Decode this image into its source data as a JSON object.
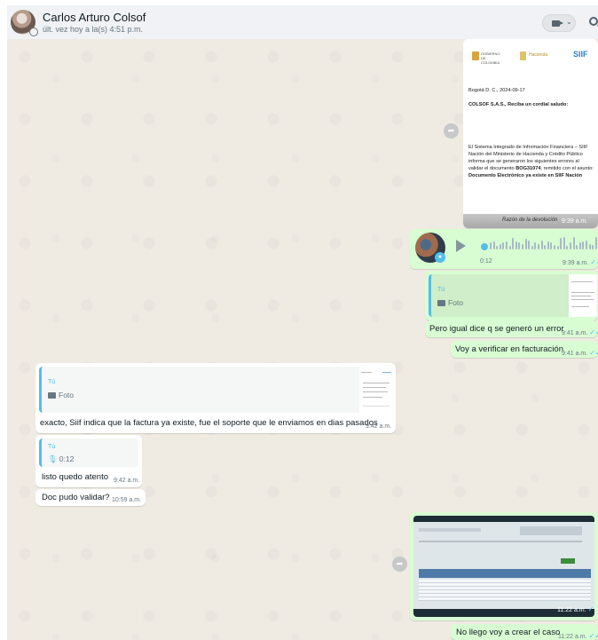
{
  "header": {
    "contact_name": "Carlos Arturo Colsof",
    "status": "últ. vez hoy a la(s) 4:51 p.m.",
    "video_chevron": "⌄"
  },
  "colors": {
    "outgoing": "#d9fdd3",
    "incoming": "#ffffff",
    "chat_bg": "#efeae2",
    "header_bg": "#f0f2f5",
    "accent": "#53bdeb"
  },
  "messages": {
    "doc": {
      "logo_left": "GOBIERNO DE COLOMBIA",
      "logo_mid": "Hacienda",
      "logo_right": "SIIF",
      "date_line": "Bogotá D. C., 2024-09-17",
      "greeting": "COLSOF S.A.S., Reciba un cordial saludo:",
      "body_a": "El Sistema Integrado de Información Financiera – SIIF Nación del Ministerio de Hacienda y Crédito Público informa que se generaron los siguientes errores al validar el documento",
      "doc_id": "BOG31074",
      "body_b": ", remitido con el asunto:",
      "subject": "Documento Electrónico ya existe en SIIF Nación",
      "footer": "Razón de la devolución",
      "time": "9:39 a.m."
    },
    "audio": {
      "duration": "0:12",
      "time": "9:39 a.m.",
      "ticks": "✓✓"
    },
    "quoted_photo_out": {
      "author": "Tú",
      "label": "Foto"
    },
    "out_1": {
      "text": "Pero igual dice q se generó un error",
      "time": "9:41 a.m.",
      "ticks": "✓✓"
    },
    "out_2": {
      "text": "Voy a verificar en facturación",
      "time": "9:41 a.m.",
      "ticks": "✓✓"
    },
    "in_1": {
      "quote_author": "Tú",
      "quote_label": "Foto",
      "text": "exacto, Siif indica que la factura ya existe, fue el soporte que le enviamos en dias pasados",
      "time": "9:42 a.m."
    },
    "in_2": {
      "quote_author": "Tú",
      "quote_duration": "0:12",
      "text": "listo quedo atento",
      "time": "9:42 a.m."
    },
    "in_3": {
      "text": "Doc pudo validar?",
      "time": "10:59 a.m."
    },
    "video": {
      "time": "11:22 a.m.",
      "ticks": "✓✓"
    },
    "out_3": {
      "text": "No llego voy a crear el caso",
      "time": "11:22 a.m.",
      "ticks": "✓✓"
    }
  }
}
